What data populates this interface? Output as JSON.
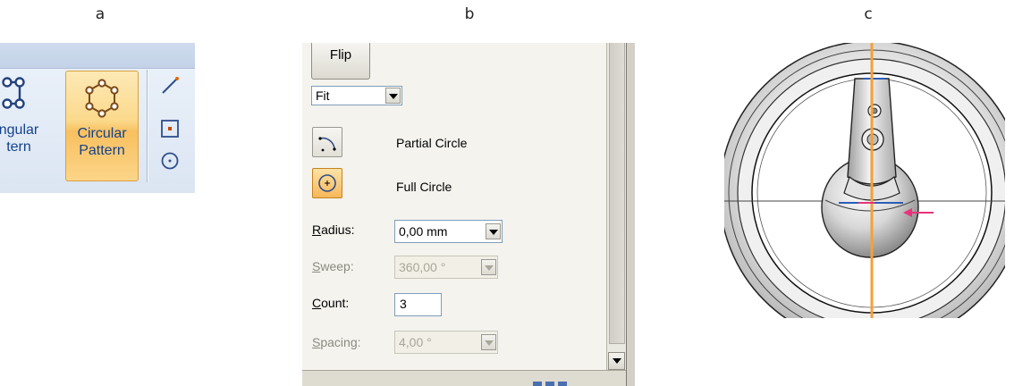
{
  "panel_labels": {
    "a": "a",
    "b": "b",
    "c": "c"
  },
  "ribbon": {
    "angular_pattern_label": "ngular\ntern",
    "circular_pattern_label": "Circular\nPattern",
    "small_tools": [
      "line-icon",
      "point-icon",
      "circle-icon"
    ],
    "accent_color": "#f8c060"
  },
  "dialog": {
    "flip_label": "Flip",
    "fit_select": "Fit",
    "partial_circle_label": "Partial Circle",
    "full_circle_label": "Full Circle",
    "radius": {
      "label_key": "R",
      "label_rest": "adius:",
      "value": "0,00 mm"
    },
    "sweep": {
      "label_key": "S",
      "label_rest": "weep:",
      "value": "360,00 °"
    },
    "count": {
      "label_key": "C",
      "label_rest": "ount:",
      "value": "3"
    },
    "spacing": {
      "label_key": "S",
      "label_rest": "pacing:",
      "value": "4,00 °"
    }
  },
  "viewport": {
    "axis_color": "#f4a038",
    "handle_color": "#e8337a"
  }
}
